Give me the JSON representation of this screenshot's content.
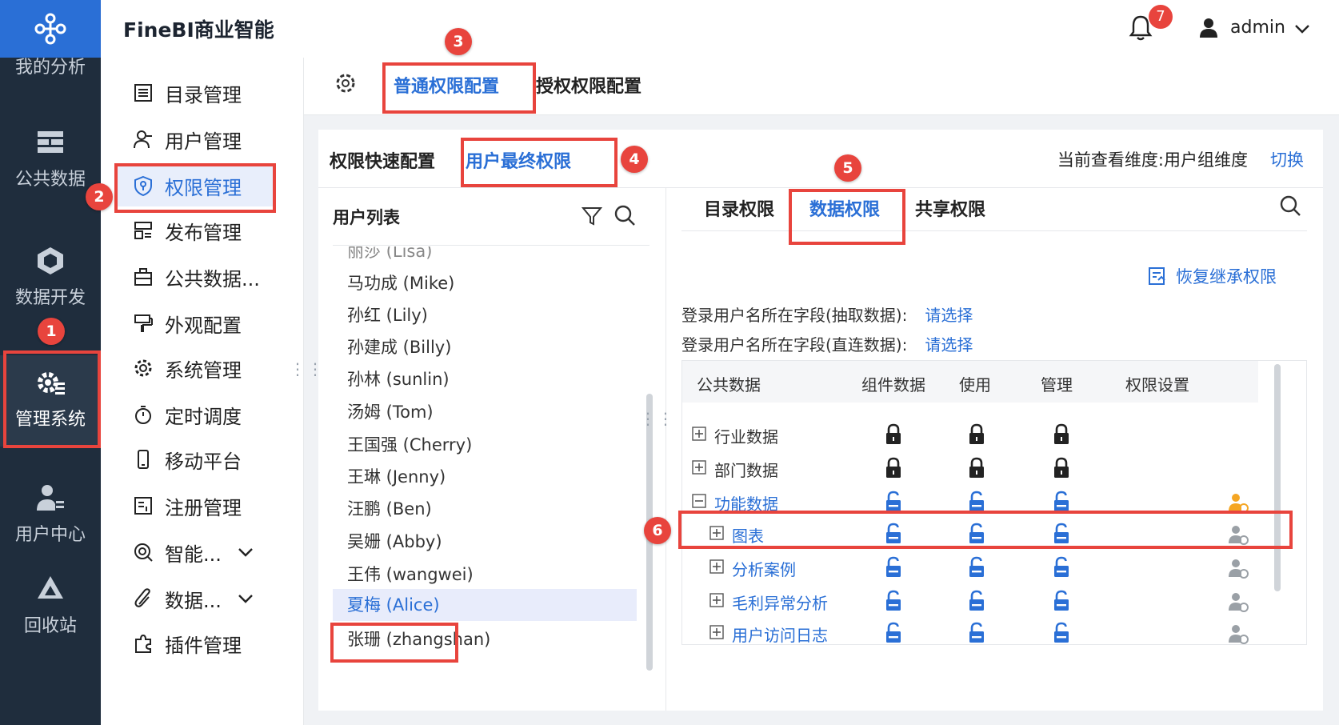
{
  "header": {
    "brand": "FineBI商业智能",
    "notification_count": "7",
    "user": "admin"
  },
  "sidebar": {
    "items": [
      {
        "label": "我的分析",
        "icon": "analysis-icon"
      },
      {
        "label": "公共数据",
        "icon": "public-data-icon"
      },
      {
        "label": "数据开发",
        "icon": "data-dev-icon"
      },
      {
        "label": "管理系统",
        "icon": "admin-system-icon",
        "active": true
      },
      {
        "label": "用户中心",
        "icon": "user-center-icon"
      },
      {
        "label": "回收站",
        "icon": "recycle-icon"
      }
    ]
  },
  "menu": {
    "items": [
      {
        "label": "目录管理",
        "icon": "catalog-icon"
      },
      {
        "label": "用户管理",
        "icon": "user-icon"
      },
      {
        "label": "权限管理",
        "icon": "permission-icon",
        "active": true
      },
      {
        "label": "发布管理",
        "icon": "publish-icon"
      },
      {
        "label": "公共数据...",
        "icon": "public-data-icon"
      },
      {
        "label": "外观配置",
        "icon": "appearance-icon"
      },
      {
        "label": "系统管理",
        "icon": "system-gear-icon"
      },
      {
        "label": "定时调度",
        "icon": "timer-icon"
      },
      {
        "label": "移动平台",
        "icon": "mobile-icon"
      },
      {
        "label": "注册管理",
        "icon": "register-icon"
      },
      {
        "label": "智能...",
        "icon": "smart-icon"
      },
      {
        "label": "数据...",
        "icon": "data-link-icon"
      },
      {
        "label": "插件管理",
        "icon": "plugin-icon"
      }
    ]
  },
  "top_tabs": {
    "normal": "普通权限配置",
    "grant": "授权权限配置"
  },
  "panel": {
    "tabs": {
      "quick": "权限快速配置",
      "final": "用户最终权限"
    },
    "dimension_text": "当前查看维度:用户组维度",
    "switch_label": "切换"
  },
  "user_list": {
    "title": "用户列表",
    "partial_top": "丽莎 (Lisa)",
    "users": [
      "马功成 (Mike)",
      "孙红 (Lily)",
      "孙建成 (Billy)",
      "孙林 (sunlin)",
      "汤姆 (Tom)",
      "王国强 (Cherry)",
      "王琳 (Jenny)",
      "汪鹏 (Ben)",
      "吴姗 (Abby)",
      "王伟 (wangwei)",
      "夏梅 (Alice)",
      "张珊 (zhangshan)"
    ],
    "selected": "夏梅 (Alice)"
  },
  "right": {
    "tabs": {
      "catalog": "目录权限",
      "data": "数据权限",
      "share": "共享权限"
    },
    "restore_label": "恢复继承权限",
    "field_extract_label": "登录用户名所在字段(抽取数据):",
    "field_direct_label": "登录用户名所在字段(直连数据):",
    "pick_label": "请选择",
    "columns": {
      "public_data": "公共数据",
      "component_data": "组件数据",
      "use": "使用",
      "manage": "管理",
      "perm_setting": "权限设置"
    },
    "rows": [
      {
        "label": "行业数据",
        "level": 0,
        "expander": "plus",
        "locked": true,
        "color": "#333"
      },
      {
        "label": "部门数据",
        "level": 0,
        "expander": "plus",
        "locked": true,
        "color": "#333"
      },
      {
        "label": "功能数据",
        "level": 0,
        "expander": "minus",
        "locked": false,
        "color": "#2a6fd6",
        "perm": "orange"
      },
      {
        "label": "图表",
        "level": 1,
        "expander": "plus",
        "locked": false,
        "color": "#2a6fd6",
        "perm": "gray"
      },
      {
        "label": "分析案例",
        "level": 1,
        "expander": "plus",
        "locked": false,
        "color": "#2a6fd6",
        "perm": "gray"
      },
      {
        "label": "毛利异常分析",
        "level": 1,
        "expander": "plus",
        "locked": false,
        "color": "#2a6fd6",
        "perm": "gray"
      },
      {
        "label": "用户访问日志",
        "level": 1,
        "expander": "plus",
        "locked": false,
        "color": "#2a6fd6",
        "perm": "gray"
      }
    ]
  },
  "annotations": [
    "1",
    "2",
    "3",
    "4",
    "5",
    "6"
  ],
  "colors": {
    "accent": "#2a6fd6",
    "sidebar": "#1f2d3d",
    "annotation_red": "#e8443d",
    "perm_orange": "#f5a623"
  }
}
